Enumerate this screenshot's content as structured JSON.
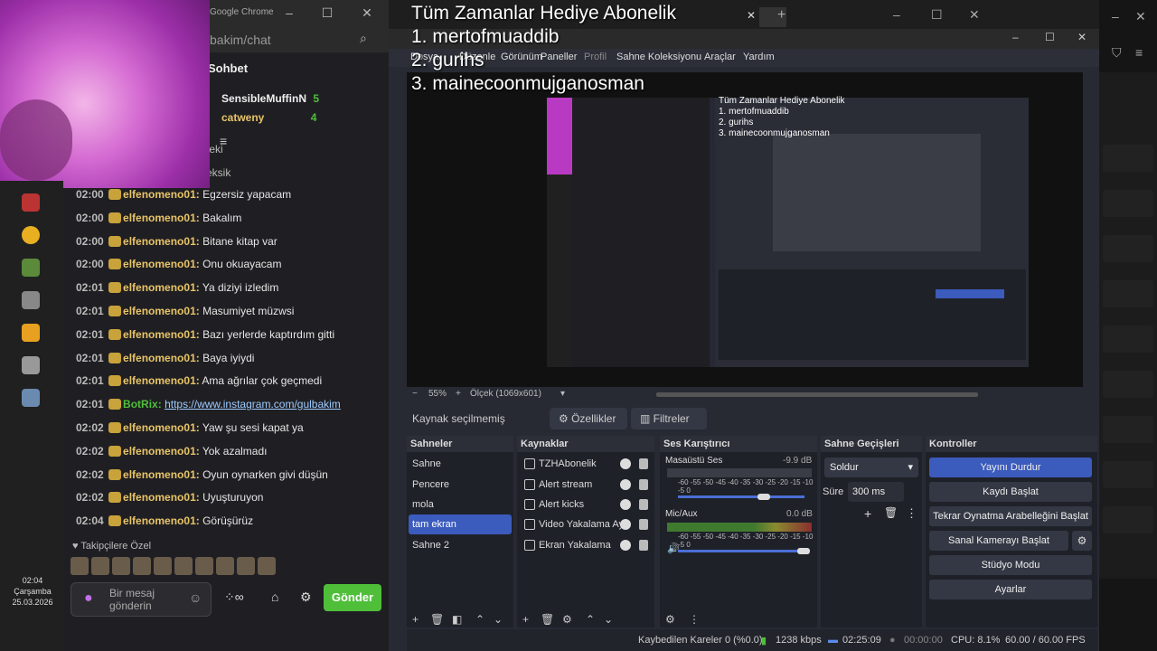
{
  "chrome": {
    "title": "Google Chrome",
    "url": "bakim/chat"
  },
  "chat": {
    "header": "Sohbet",
    "top_users": [
      {
        "name": "SensibleMuffinN",
        "count": "5"
      },
      {
        "name": "catweny",
        "count": "4"
      }
    ],
    "partial_lines": [
      "teki",
      "eksik"
    ],
    "messages": [
      {
        "time": "02:00",
        "user": "elfenomeno01:",
        "text": "Egzersiz yapacam"
      },
      {
        "time": "02:00",
        "user": "elfenomeno01:",
        "text": "Bakalım"
      },
      {
        "time": "02:00",
        "user": "elfenomeno01:",
        "text": "Bitane kitap var"
      },
      {
        "time": "02:00",
        "user": "elfenomeno01:",
        "text": "Onu okuayacam"
      },
      {
        "time": "02:01",
        "user": "elfenomeno01:",
        "text": "Ya diziyi izledim"
      },
      {
        "time": "02:01",
        "user": "elfenomeno01:",
        "text": "Masumiyet müzwsi"
      },
      {
        "time": "02:01",
        "user": "elfenomeno01:",
        "text": "Bazı yerlerde kaptırdım gitti"
      },
      {
        "time": "02:01",
        "user": "elfenomeno01:",
        "text": "Baya iyiydi"
      },
      {
        "time": "02:01",
        "user": "elfenomeno01:",
        "text": "Ama ağrılar çok geçmedi"
      },
      {
        "time": "02:01",
        "user": "BotRix:",
        "text": "https://www.instagram.com/gulbakim",
        "link": true
      },
      {
        "time": "02:02",
        "user": "elfenomeno01:",
        "text": "Yaw şu sesi kapat ya"
      },
      {
        "time": "02:02",
        "user": "elfenomeno01:",
        "text": "Yok azalmadı"
      },
      {
        "time": "02:02",
        "user": "elfenomeno01:",
        "text": "Oyun oynarken givi düşün"
      },
      {
        "time": "02:02",
        "user": "elfenomeno01:",
        "text": "Uyuşturuyon"
      },
      {
        "time": "02:04",
        "user": "elfenomeno01:",
        "text": "Görüşürüz"
      }
    ],
    "followers_label": "Takipçilere Özel",
    "input_placeholder": "Bir mesaj gönderin",
    "send_label": "Gönder"
  },
  "clock": {
    "time": "02:04",
    "day": "Çarşamba",
    "date": "25.03.2026"
  },
  "overlay": {
    "title": "Tüm Zamanlar Hediye Abonelik",
    "lines": [
      "1. mertofmuaddib",
      "2. gurihs",
      "3. mainecoonmujganosman"
    ]
  },
  "obs": {
    "menu": [
      "Dosya",
      "Düzenle",
      "Görünüm",
      "Paneller",
      "Profil",
      "Sahne Koleksiyonu",
      "Araçlar",
      "Yardım"
    ],
    "zoom": "55%",
    "scale": "Ölçek (1069x601)",
    "no_source": "Kaynak seçilmemiş",
    "properties": "Özellikler",
    "filters": "Filtreler",
    "docks": {
      "scenes": "Sahneler",
      "sources": "Kaynaklar",
      "mixer": "Ses Karıştırıcı",
      "transitions": "Sahne Geçişleri",
      "controls": "Kontroller"
    },
    "scenes": [
      "Sahne",
      "Pencere",
      "mola",
      "tam ekran",
      "Sahne 2"
    ],
    "selected_scene": "tam ekran",
    "sources": [
      "TZHAbonelik",
      "Alert stream",
      "Alert kicks",
      "Video Yakalama Ay",
      "Ekran Yakalama"
    ],
    "mixer": [
      {
        "name": "Masaüstü Ses",
        "db": "-9.9 dB",
        "level": 0.0
      },
      {
        "name": "Mic/Aux",
        "db": "0.0 dB",
        "level": 1.0
      }
    ],
    "meter_scale": "-60 -55 -50 -45 -40 -35 -30 -25 -20 -15 -10 -5 0",
    "transition": "Soldur",
    "duration_label": "Süre",
    "duration": "300 ms",
    "controls": [
      "Yayını Durdur",
      "Kaydı Başlat",
      "Tekrar Oynatma Arabelleğini Başlat",
      "Sanal Kamerayı Başlat",
      "Stüdyo Modu",
      "Ayarlar"
    ],
    "status": {
      "dropped": "Kaybedilen Kareler 0 (%0.0)",
      "bitrate": "1238 kbps",
      "stream_time": "02:25:09",
      "rec_time": "00:00:00",
      "cpu": "CPU: 8.1%",
      "fps": "60.00 / 60.00 FPS"
    }
  },
  "colors": {
    "accent": "#3b5bbd",
    "send": "#4fbf3a",
    "username": "#e8c468"
  }
}
